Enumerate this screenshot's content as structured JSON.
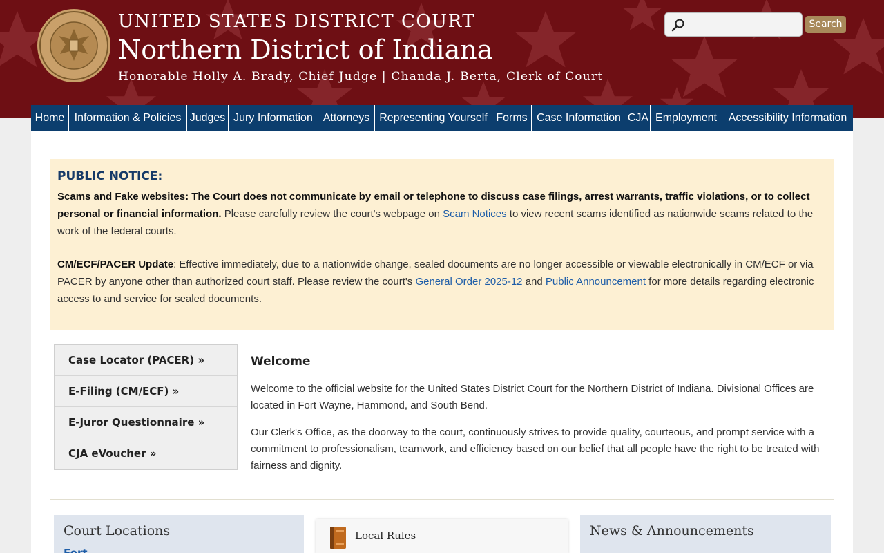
{
  "header": {
    "line1": "UNITED STATES DISTRICT COURT",
    "line2": "Northern District of Indiana",
    "line3": "Honorable Holly A. Brady, Chief Judge | Chanda J. Berta, Clerk of Court",
    "seal_icon": "court-seal-icon",
    "colors": {
      "banner": "#6e0f14",
      "nav": "#0c3e6e",
      "search_button": "#a8895a"
    }
  },
  "search": {
    "placeholder": "",
    "value": "",
    "button_label": "Search"
  },
  "nav": {
    "items": [
      "Home",
      "Information & Policies",
      "Judges",
      "Jury Information",
      "Attorneys",
      "Representing Yourself",
      "Forms",
      "Case Information",
      "CJA",
      "Employment",
      "Accessibility Information"
    ]
  },
  "notice": {
    "title": "PUBLIC NOTICE:",
    "p1_bold": "Scams and Fake websites: The Court does not communicate by email or telephone to discuss case filings, arrest warrants, traffic violations, or to collect personal or financial information.",
    "p1_text": " Please carefully review the court's webpage on ",
    "p1_link": "Scam Notices",
    "p1_tail": " to view recent scams identified as nationwide scams related to the work of the federal courts.",
    "p2_bold": "CM/ECF/PACER Update",
    "p2_text": ": Effective immediately, due to a nationwide change, sealed documents are no longer accessible or viewable electronically in CM/ECF or via PACER by anyone other than authorized court staff. Please review the court's ",
    "p2_link1": "General Order 2025-12",
    "p2_and": " and ",
    "p2_link2": "Public Announcement",
    "p2_tail": " for more details regarding electronic access to and service for sealed documents."
  },
  "quicklinks": [
    "Case Locator (PACER) »",
    "E-Filing (CM/ECF) »",
    "E-Juror Questionnaire »",
    "CJA eVoucher »"
  ],
  "welcome": {
    "title": "Welcome",
    "p1": "Welcome to the official website for the United States District Court for the Northern District of Indiana.  Divisional Offices are located in Fort Wayne, Hammond, and South Bend.",
    "p2": "Our Clerk's Office, as the doorway to the court, continuously strives to provide quality, courteous, and prompt service with a commitment to professionalism, teamwork, and efficiency based on our belief that all people have the right to be treated with fairness and dignity."
  },
  "cards": {
    "locations_title": "Court Locations",
    "locations_first": "Fort Wayne",
    "rules_title": "Local Rules",
    "rules_icon": "book-icon",
    "news_title": "News & Announcements"
  }
}
